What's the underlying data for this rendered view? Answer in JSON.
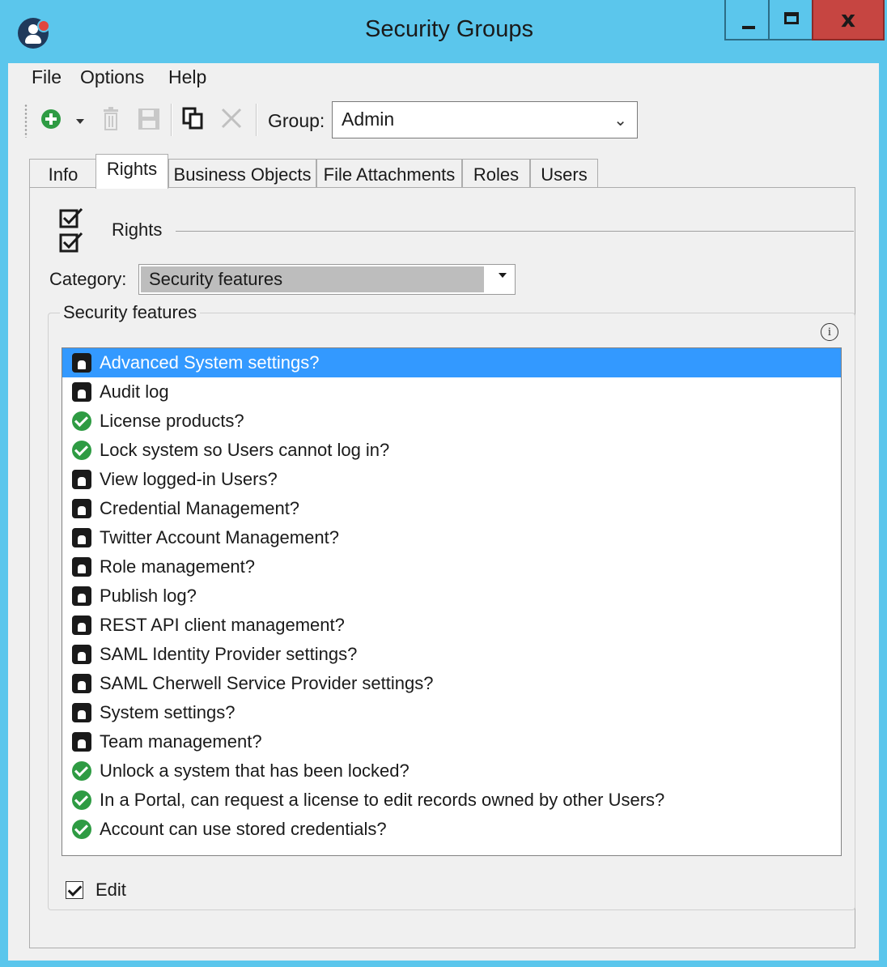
{
  "window": {
    "title": "Security Groups",
    "minimize_icon": "minimize-icon",
    "maximize_icon": "maximize-icon",
    "close_label": "x"
  },
  "menu": {
    "items": [
      {
        "label": "File"
      },
      {
        "label": "Options"
      },
      {
        "label": "Help"
      }
    ]
  },
  "toolbar": {
    "tools": [
      "add-icon",
      "dropdown-arrow-icon",
      "delete-icon",
      "save-icon",
      "copy-icon",
      "cancel-icon"
    ],
    "group_label": "Group:",
    "group_value": "Admin"
  },
  "tabs": [
    {
      "label": "Info",
      "active": false
    },
    {
      "label": "Rights",
      "active": true
    },
    {
      "label": "Business Objects",
      "active": false
    },
    {
      "label": "File Attachments",
      "active": false
    },
    {
      "label": "Roles",
      "active": false
    },
    {
      "label": "Users",
      "active": false
    }
  ],
  "rights": {
    "section_title": "Rights",
    "category_label": "Category:",
    "category_value": "Security features",
    "group_title": "Security features",
    "info_icon": "info-icon",
    "features": [
      {
        "label": "Advanced System settings?",
        "status": "locked",
        "selected": true
      },
      {
        "label": "Audit log",
        "status": "locked",
        "selected": false
      },
      {
        "label": "License products?",
        "status": "granted",
        "selected": false
      },
      {
        "label": "Lock system so Users cannot log in?",
        "status": "granted",
        "selected": false
      },
      {
        "label": "View logged-in Users?",
        "status": "locked",
        "selected": false
      },
      {
        "label": "Credential Management?",
        "status": "locked",
        "selected": false
      },
      {
        "label": "Twitter Account Management?",
        "status": "locked",
        "selected": false
      },
      {
        "label": "Role management?",
        "status": "locked",
        "selected": false
      },
      {
        "label": "Publish log?",
        "status": "locked",
        "selected": false
      },
      {
        "label": "REST API client management?",
        "status": "locked",
        "selected": false
      },
      {
        "label": "SAML Identity Provider settings?",
        "status": "locked",
        "selected": false
      },
      {
        "label": "SAML Cherwell Service Provider settings?",
        "status": "locked",
        "selected": false
      },
      {
        "label": "System settings?",
        "status": "locked",
        "selected": false
      },
      {
        "label": "Team management?",
        "status": "locked",
        "selected": false
      },
      {
        "label": "Unlock a system that has been locked?",
        "status": "granted",
        "selected": false
      },
      {
        "label": "In a Portal, can request a license to edit records owned by other Users?",
        "status": "granted",
        "selected": false
      },
      {
        "label": "Account can use stored credentials?",
        "status": "granted",
        "selected": false
      }
    ],
    "edit_label": "Edit",
    "edit_checked": true
  },
  "colors": {
    "titlebar": "#5bc6ec",
    "close_button": "#c64541",
    "selection": "#3399ff",
    "granted": "#2e9b43"
  }
}
